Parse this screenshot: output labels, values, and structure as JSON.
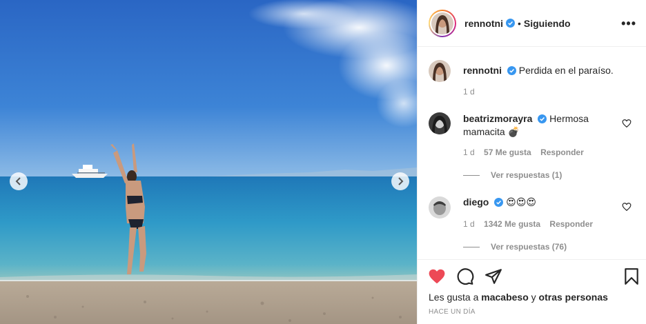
{
  "post": {
    "username": "rennotni",
    "follow_status": "Siguiendo",
    "separator": "•",
    "more_label": "•••"
  },
  "caption": {
    "username": "rennotni",
    "text": "Perdida en el paraíso.",
    "time": "1 d"
  },
  "comments": [
    {
      "username": "beatrizmorayra",
      "text": "Hermosa mamacita 💣",
      "time": "1 d",
      "likes": "57 Me gusta",
      "reply_label": "Responder",
      "view_replies": "Ver respuestas (1)"
    },
    {
      "username": "diego",
      "text": "😍😍😍",
      "time": "1 d",
      "likes": "1342 Me gusta",
      "reply_label": "Responder",
      "view_replies": "Ver respuestas (76)"
    }
  ],
  "likes_line": {
    "prefix": "Les gusta a ",
    "user": "macabeso",
    "conjunction": " y ",
    "others": "otras personas"
  },
  "timestamp": "HACE UN DÍA",
  "icons": {
    "like": "heart-filled-icon",
    "comment": "comment-bubble-icon",
    "share": "paper-plane-icon",
    "save": "bookmark-icon",
    "verified": "verified-badge-icon",
    "prev": "chevron-left-icon",
    "next": "chevron-right-icon"
  },
  "colors": {
    "like_red": "#ed4956",
    "verified_blue": "#3897f0",
    "muted_text": "#8e8e8e"
  }
}
